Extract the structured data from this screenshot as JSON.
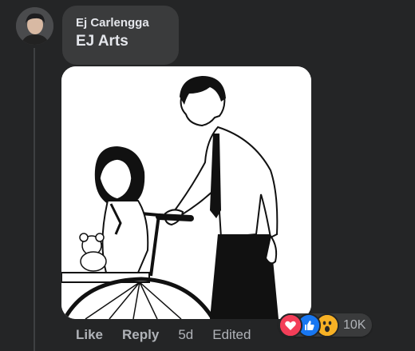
{
  "comment": {
    "author": "Ej Carlengga",
    "text": "EJ Arts",
    "time": "5d",
    "edited_label": "Edited"
  },
  "actions": {
    "like_label": "Like",
    "reply_label": "Reply"
  },
  "reactions": {
    "icons": [
      "heart-icon",
      "like-icon",
      "wow-icon"
    ],
    "count": "10K",
    "colors": {
      "heart": "#f33e58",
      "like": "#1877f2",
      "wow": "#f7b125"
    }
  },
  "image": {
    "description_icon": "manga-illustration"
  },
  "colors": {
    "background": "#242526",
    "bubble": "#3a3b3c",
    "text_primary": "#e4e6eb",
    "text_secondary": "#b0b3b8"
  }
}
